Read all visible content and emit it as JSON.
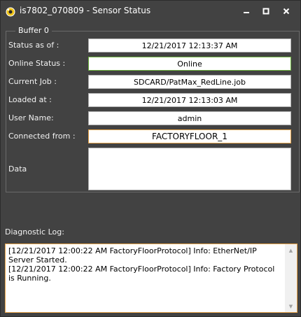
{
  "window": {
    "title": "is7802_070809 - Sensor Status",
    "icon": "sensor-app-icon",
    "controls": [
      "minimize-icon",
      "maximize-icon",
      "close-icon"
    ]
  },
  "buffer": {
    "label": "Buffer 0",
    "fields": [
      {
        "label": "Status as of :",
        "value": "12/21/2017 12:13:37 AM"
      },
      {
        "label": "Online Status :",
        "value": "Online"
      },
      {
        "label": "Current Job :",
        "value": "SDCARD/PatMax_RedLine.job"
      },
      {
        "label": "Loaded at :",
        "value": "12/21/2017 12:13:03 AM"
      },
      {
        "label": "User Name:",
        "value": "admin"
      },
      {
        "label": "Connected from :",
        "value": "FACTORYFLOOR_1"
      },
      {
        "label": "Data",
        "value": ""
      }
    ]
  },
  "diagnostic": {
    "label": "Diagnostic Log:",
    "lines": [
      "[12/21/2017 12:00:22 AM FactoryFloorProtocol] Info: EtherNet/IP Server Started.",
      "[12/21/2017 12:00:22 AM FactoryFloorProtocol] Info: Factory Protocol is Running."
    ]
  },
  "colors": {
    "background": "#424242",
    "online_border": "#6db33f",
    "focus_border": "#e8a44a"
  }
}
